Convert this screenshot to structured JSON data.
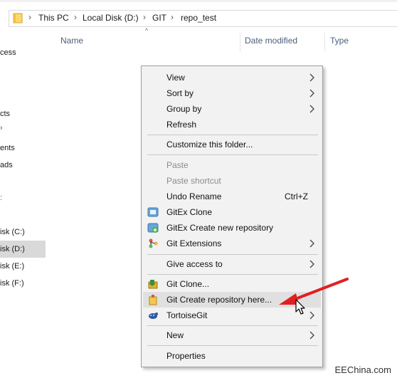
{
  "address_bar": {
    "crumbs": [
      "This PC",
      "Local Disk (D:)",
      "GIT",
      "repo_test"
    ],
    "separator": "›"
  },
  "nav_pane": {
    "items": [
      {
        "label": "cess",
        "selected": false
      },
      {
        "label": "cts",
        "selected": false
      },
      {
        "label": "ents",
        "selected": false
      },
      {
        "label": "ads",
        "selected": false
      },
      {
        "label": "isk (C:)",
        "selected": false
      },
      {
        "label": "isk (D:)",
        "selected": true
      },
      {
        "label": "isk (E:)",
        "selected": false
      },
      {
        "label": "isk (F:)",
        "selected": false
      }
    ]
  },
  "columns": {
    "name": "Name",
    "date_modified": "Date modified",
    "type": "Type"
  },
  "context_menu": {
    "items": [
      {
        "label": "View",
        "submenu": true
      },
      {
        "label": "Sort by",
        "submenu": true
      },
      {
        "label": "Group by",
        "submenu": true
      },
      {
        "label": "Refresh"
      },
      {
        "label": "Customize this folder..."
      },
      {
        "label": "Paste",
        "disabled": true
      },
      {
        "label": "Paste shortcut",
        "disabled": true
      },
      {
        "label": "Undo Rename",
        "shortcut": "Ctrl+Z"
      },
      {
        "label": "GitEx Clone",
        "icon": "gitex-clone-icon"
      },
      {
        "label": "GitEx Create new repository",
        "icon": "gitex-create-icon"
      },
      {
        "label": "Git Extensions",
        "icon": "git-extensions-icon",
        "submenu": true
      },
      {
        "label": "Give access to",
        "submenu": true
      },
      {
        "label": "Git Clone...",
        "icon": "tortoise-clone-icon"
      },
      {
        "label": "Git Create repository here...",
        "icon": "tortoise-create-icon",
        "highlighted": true
      },
      {
        "label": "TortoiseGit",
        "icon": "tortoisegit-icon",
        "submenu": true
      },
      {
        "label": "New",
        "submenu": true
      },
      {
        "label": "Properties"
      }
    ]
  },
  "colors": {
    "annotation_arrow": "#e02020",
    "selected_nav": "#d9d9d9",
    "menu_bg": "#f2f2f2"
  },
  "watermark": "EEChina.com"
}
